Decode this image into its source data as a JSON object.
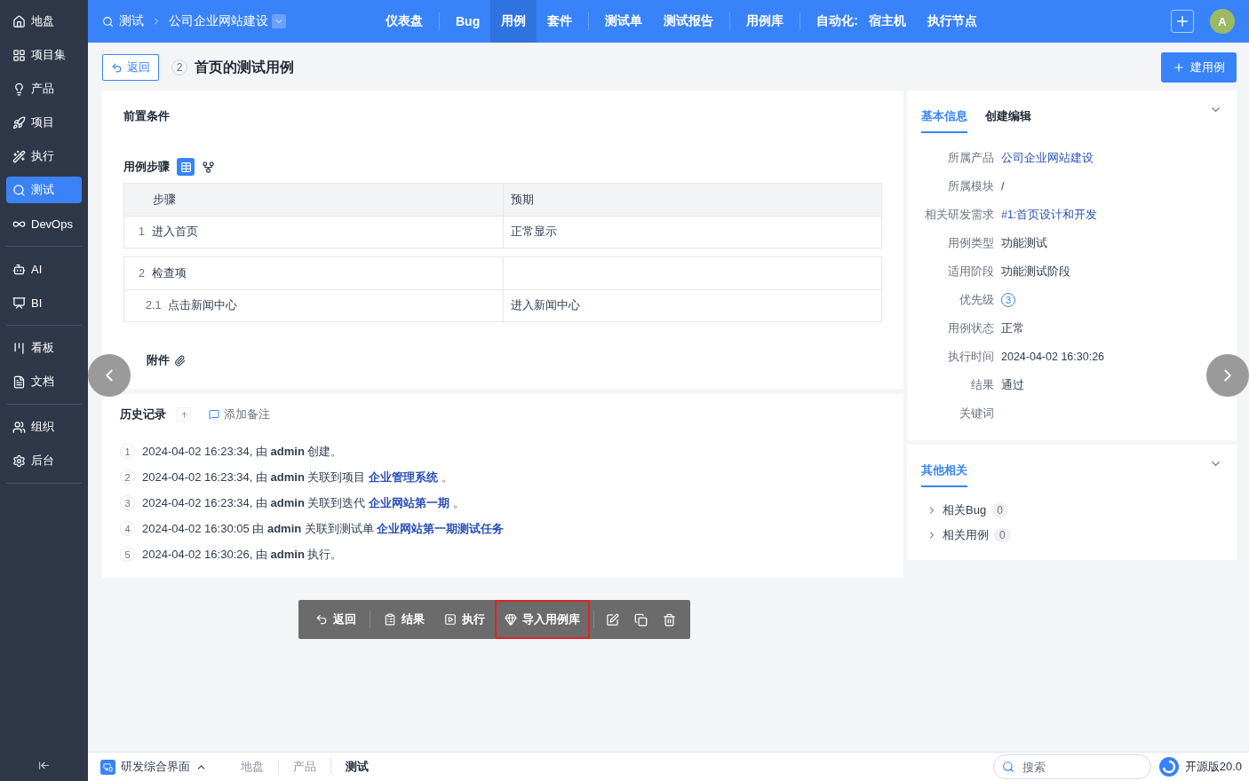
{
  "sidebar": {
    "groups": [
      {
        "items": [
          {
            "label": "地盘",
            "selected": false
          },
          {
            "label": "项目集",
            "selected": false
          },
          {
            "label": "产品",
            "selected": false
          },
          {
            "label": "项目",
            "selected": false
          },
          {
            "label": "执行",
            "selected": false
          },
          {
            "label": "测试",
            "selected": true
          },
          {
            "label": "DevOps",
            "selected": false
          }
        ]
      },
      {
        "items": [
          {
            "label": "AI",
            "selected": false
          },
          {
            "label": "BI",
            "selected": false
          }
        ]
      },
      {
        "items": [
          {
            "label": "看板",
            "selected": false
          },
          {
            "label": "文档",
            "selected": false
          }
        ]
      },
      {
        "items": [
          {
            "label": "组织",
            "selected": false
          },
          {
            "label": "后台",
            "selected": false
          }
        ]
      }
    ]
  },
  "topbar": {
    "breadcrumb": [
      "测试",
      "公司企业网站建设"
    ],
    "nav_groups": [
      {
        "items": [
          {
            "label": "仪表盘",
            "selected": false
          }
        ]
      },
      {
        "items": [
          {
            "label": "Bug",
            "selected": false
          },
          {
            "label": "用例",
            "selected": true
          },
          {
            "label": "套件",
            "selected": false
          }
        ]
      },
      {
        "items": [
          {
            "label": "测试单",
            "selected": false
          },
          {
            "label": "测试报告",
            "selected": false
          }
        ]
      },
      {
        "items": [
          {
            "label": "用例库",
            "selected": false
          }
        ]
      },
      {
        "label": "自动化:",
        "items": [
          {
            "label": "宿主机",
            "selected": false
          },
          {
            "label": "执行节点",
            "selected": false
          }
        ]
      }
    ],
    "avatar": "A"
  },
  "header": {
    "back": "返回",
    "case_id": "2",
    "title": "首页的测试用例",
    "create": "建用例"
  },
  "precondition": {
    "title": "前置条件"
  },
  "steps": {
    "title": "用例步骤",
    "columns": [
      "步骤",
      "预期"
    ],
    "groups": [
      {
        "number": "1",
        "step": "进入首页",
        "expected": "正常显示"
      },
      {
        "number": "2",
        "step": "检查项",
        "children": [
          {
            "number": "2.1",
            "step": "点击新闻中心",
            "expected": "进入新闻中心"
          }
        ]
      }
    ]
  },
  "attachments": {
    "title": "附件"
  },
  "history": {
    "title": "历史记录",
    "add_note": "添加备注",
    "entries": [
      {
        "number": "1",
        "text": "2024-04-02 16:23:34, 由 **admin** 创建。"
      },
      {
        "number": "2",
        "text": "2024-04-02 16:23:34, 由 **admin** 关联到项目",
        "link": "企业管理系统",
        "suffix": "。"
      },
      {
        "number": "3",
        "text": "2024-04-02 16:23:34, 由 **admin** 关联到迭代",
        "link": "企业网站第一期",
        "suffix": "。"
      },
      {
        "number": "4",
        "text": "2024-04-02 16:30:05 由 **admin** 关联到测试单",
        "link": "企业网站第一期测试任务"
      },
      {
        "number": "5",
        "text": "2024-04-02 16:30:26, 由 **admin** 执行。"
      }
    ]
  },
  "toolbar_groups": [
    {
      "items": [
        {
          "kind": "text",
          "label": "返回",
          "highlighted": false
        }
      ]
    },
    {
      "items": [
        {
          "kind": "text",
          "label": "结果",
          "highlighted": false
        },
        {
          "kind": "text",
          "label": "执行",
          "highlighted": false
        },
        {
          "kind": "text",
          "label": "导入用例库",
          "highlighted": true
        }
      ]
    },
    {
      "items": [
        {
          "kind": "icon",
          "highlighted": false
        },
        {
          "kind": "icon",
          "highlighted": false
        },
        {
          "kind": "icon",
          "highlighted": false
        }
      ]
    }
  ],
  "info": {
    "tabs": [
      {
        "label": "基本信息",
        "selected": true
      },
      {
        "label": "创建编辑",
        "selected": false
      }
    ],
    "fields": [
      {
        "kind": "link",
        "label": "所属产品",
        "value": "公司企业网站建设"
      },
      {
        "kind": "text",
        "label": "所属模块",
        "value": "/"
      },
      {
        "kind": "link",
        "label": "相关研发需求",
        "value": "#1:首页设计和开发"
      },
      {
        "kind": "text",
        "label": "用例类型",
        "value": "功能测试"
      },
      {
        "kind": "text",
        "label": "适用阶段",
        "value": "功能测试阶段"
      },
      {
        "kind": "priority",
        "label": "优先级",
        "value": "3"
      },
      {
        "kind": "text",
        "label": "用例状态",
        "value": "正常"
      },
      {
        "kind": "text",
        "label": "执行时间",
        "value": "2024-04-02 16:30:26"
      },
      {
        "kind": "text",
        "label": "结果",
        "value": "通过"
      },
      {
        "kind": "text",
        "label": "关键词"
      }
    ]
  },
  "related": {
    "title": "其他相关",
    "items": [
      {
        "label": "相关Bug",
        "count": "0"
      },
      {
        "label": "相关用例",
        "count": "0"
      }
    ]
  },
  "bottombar": {
    "app": "研发综合界面",
    "crumbs": [
      {
        "label": "地盘",
        "selected": false
      },
      {
        "label": "产品",
        "selected": false
      },
      {
        "label": "测试",
        "selected": true
      }
    ],
    "search_placeholder": "搜索",
    "version": "开源版20.0"
  }
}
